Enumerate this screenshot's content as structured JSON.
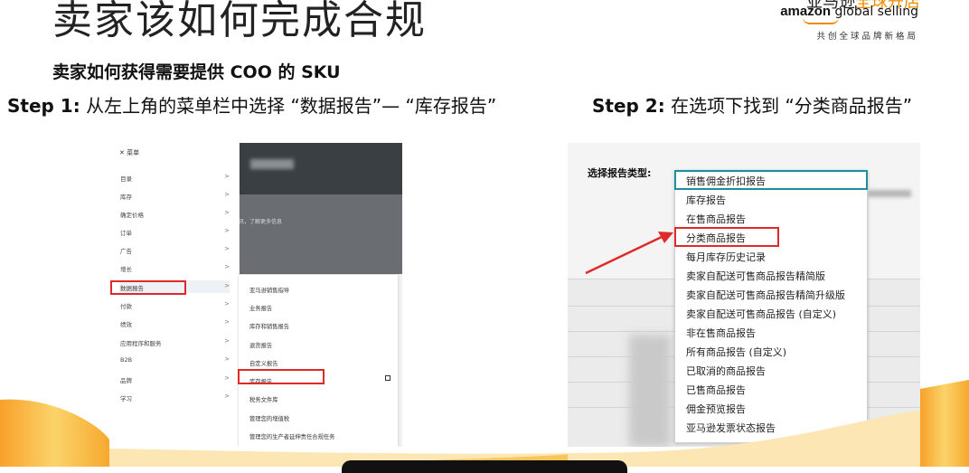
{
  "header": {
    "title": "卖家该如何完成合规",
    "logo": {
      "cn_black": "亚马逊",
      "cn_orange": "全球开店",
      "amazon": "amazon",
      "global_selling": "global selling",
      "tagline": "共创全球品牌新格局"
    }
  },
  "subtitle": "卖家如何获得需要提供 COO 的 SKU",
  "steps": {
    "step1_label": "Step 1:",
    "step1_text": " 从左上角的菜单栏中选择 “数据报告”— “库存报告”",
    "step2_label": "Step 2:",
    "step2_text": " 在选项下找到 “分类商品报告”"
  },
  "left_screenshot": {
    "menu_header": "✕  菜单",
    "menu_items": [
      {
        "label": "目录",
        "chevron": ">"
      },
      {
        "label": "库存",
        "chevron": ">"
      },
      {
        "label": "确定价格",
        "chevron": ">"
      },
      {
        "label": "订单",
        "chevron": ">"
      },
      {
        "label": "广告",
        "chevron": ">"
      },
      {
        "label": "增长",
        "chevron": ">"
      },
      {
        "label": "数据报告",
        "chevron": ">"
      },
      {
        "label": "付款",
        "chevron": ">"
      },
      {
        "label": "绩效",
        "chevron": ">"
      },
      {
        "label": "应用程序和服务",
        "chevron": ">"
      },
      {
        "label": "B2B",
        "chevron": ">"
      },
      {
        "label": "品牌",
        "chevron": ">"
      },
      {
        "label": "学习",
        "chevron": ">"
      }
    ],
    "background_text": "讯，了解更多信息",
    "submenu_items": [
      "亚马逊销售指导",
      "业务报告",
      "库存和销售报告",
      "退货报告",
      "自定义报告",
      "库存报告",
      "税务文件库",
      "管理您的增值税",
      "管理您的生产者延伸责任合规任务"
    ]
  },
  "right_screenshot": {
    "label": "选择报告类型:",
    "selected": "销售佣金折扣报告",
    "options": [
      "库存报告",
      "在售商品报告",
      "分类商品报告",
      "每月库存历史记录",
      "卖家自配送可售商品报告精简版",
      "卖家自配送可售商品报告精简升级版",
      "卖家自配送可售商品报告 (自定义)",
      "非在售商品报告",
      "所有商品报告 (自定义)",
      "已取消的商品报告",
      "已售商品报告",
      "佣金预览报告",
      "亚马逊发票状态报告"
    ]
  },
  "colors": {
    "highlight_red": "#e02a2a",
    "select_teal": "#1c8f9e",
    "brand_orange": "#f08a00"
  }
}
